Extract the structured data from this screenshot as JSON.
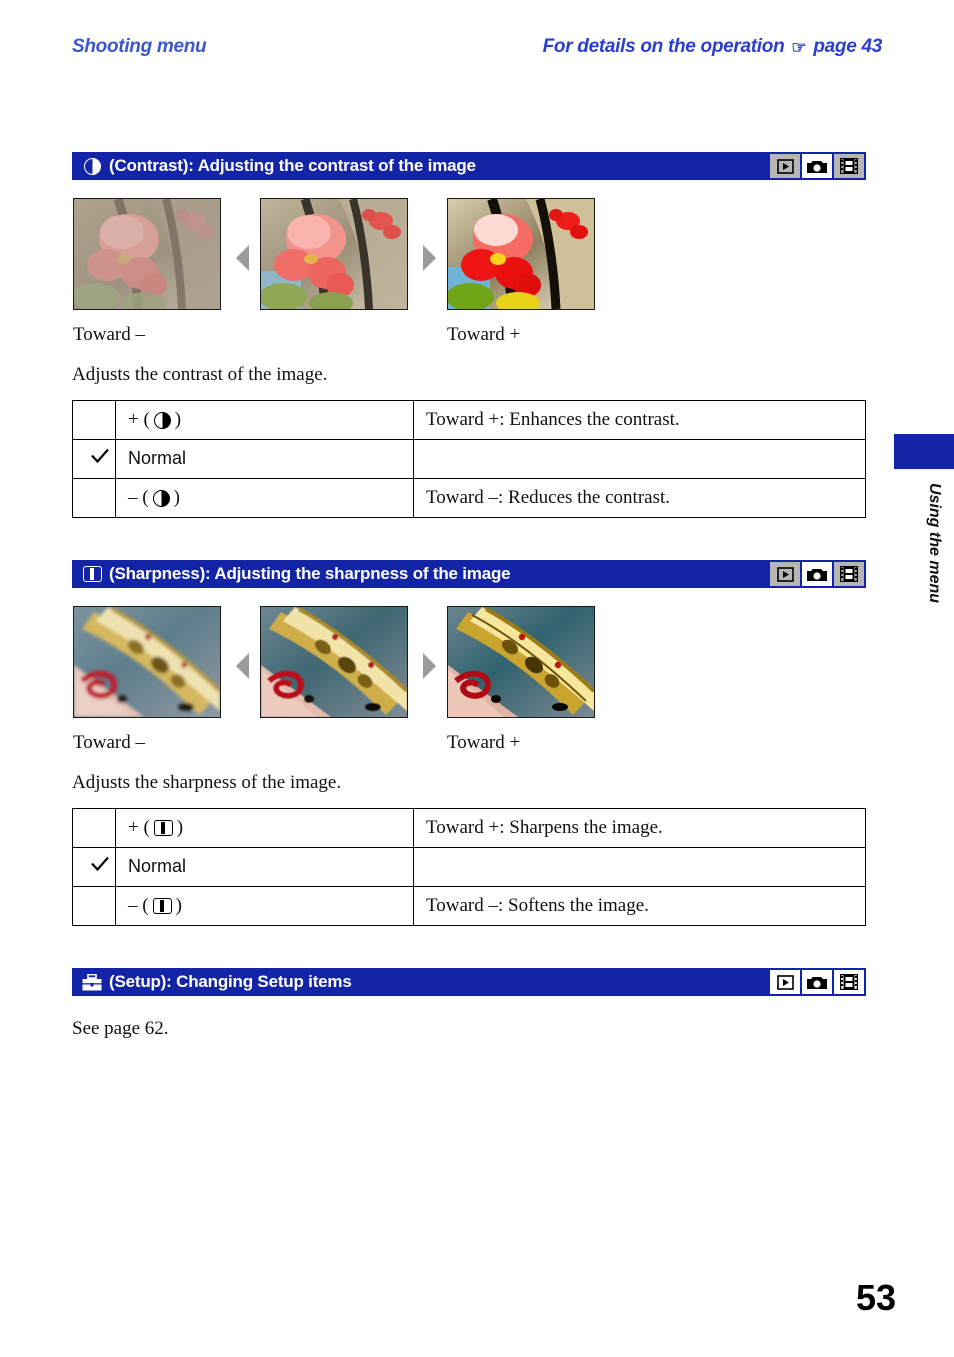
{
  "running_head": {
    "left": "Shooting menu",
    "right_prefix": "For details on the operation",
    "hand_icon": "☞",
    "right_suffix": "page 43"
  },
  "sections": [
    {
      "id": "contrast",
      "icon": "contrast-icon",
      "title": "(Contrast): Adjusting the contrast of the image",
      "modes": [
        {
          "name": "playback-mode-icon",
          "active": false
        },
        {
          "name": "camera-mode-icon",
          "active": true
        },
        {
          "name": "movie-mode-icon",
          "active": false
        }
      ],
      "samples": {
        "caption_minus": "Toward –",
        "caption_plus": "Toward +"
      },
      "intro": "Adjusts the contrast of the image.",
      "table": [
        {
          "check": false,
          "label_prefix": "+ (",
          "label_suffix": ")",
          "glyph": "contrast",
          "desc": "Toward +: Enhances the contrast."
        },
        {
          "check": true,
          "label_text": "Normal",
          "glyph": "none",
          "desc": ""
        },
        {
          "check": false,
          "label_prefix": "– (",
          "label_suffix": ")",
          "glyph": "contrast",
          "desc": "Toward –: Reduces the contrast."
        }
      ]
    },
    {
      "id": "sharpness",
      "icon": "sharpness-icon",
      "title": "(Sharpness): Adjusting the sharpness of the image",
      "modes": [
        {
          "name": "playback-mode-icon",
          "active": false
        },
        {
          "name": "camera-mode-icon",
          "active": true
        },
        {
          "name": "movie-mode-icon",
          "active": false
        }
      ],
      "samples": {
        "caption_minus": "Toward –",
        "caption_plus": "Toward +"
      },
      "intro": "Adjusts the sharpness of the image.",
      "table": [
        {
          "check": false,
          "label_prefix": "+ (",
          "label_suffix": ")",
          "glyph": "sharp",
          "desc": "Toward +: Sharpens the image."
        },
        {
          "check": true,
          "label_text": "Normal",
          "glyph": "none",
          "desc": ""
        },
        {
          "check": false,
          "label_prefix": "– (",
          "label_suffix": ")",
          "glyph": "sharp",
          "desc": "Toward –: Softens the image."
        }
      ]
    },
    {
      "id": "setup",
      "icon": "setup-toolbox-icon",
      "title": "(Setup): Changing Setup items",
      "modes": [
        {
          "name": "playback-mode-icon",
          "active": true
        },
        {
          "name": "camera-mode-icon",
          "active": true
        },
        {
          "name": "movie-mode-icon",
          "active": true
        }
      ],
      "intro": "See page 62."
    }
  ],
  "side_tab": {
    "label": "Using the menu"
  },
  "folio": "53",
  "colors": {
    "header_blue": "#1325a6",
    "running_head_blue": "#2a3fd0",
    "mode_inactive_gray": "#b5b5b5",
    "arrow_gray": "#9a9a9a"
  }
}
